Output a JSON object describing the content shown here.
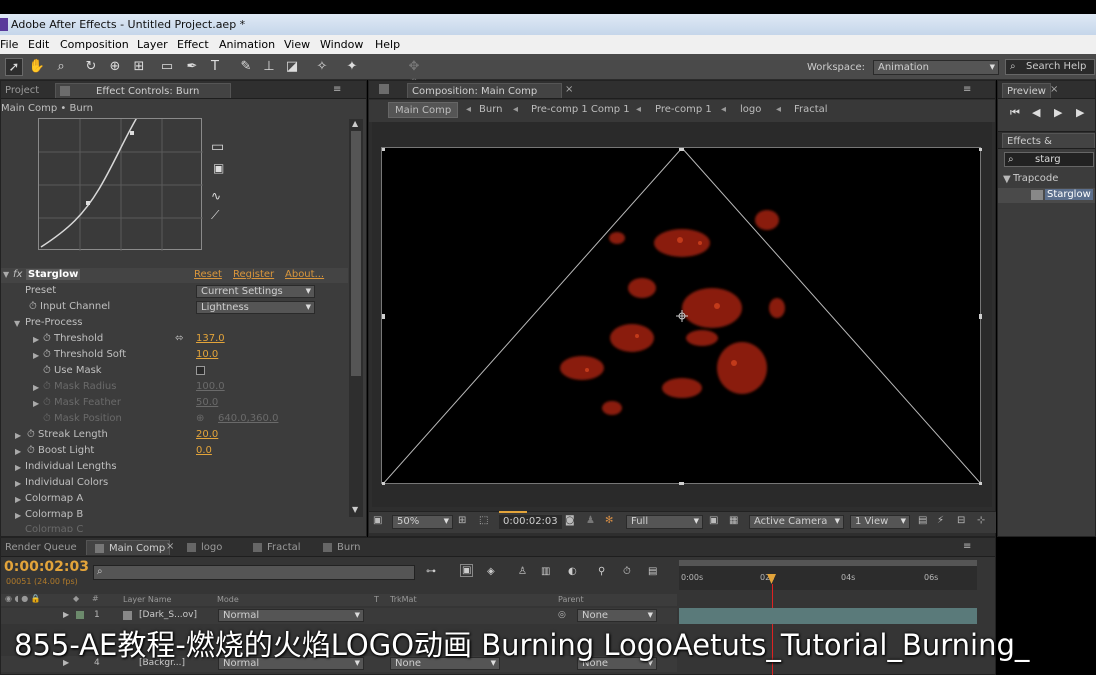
{
  "app": {
    "window_title": "Adobe After Effects - Untitled Project.aep *"
  },
  "menu": [
    "File",
    "Edit",
    "Composition",
    "Layer",
    "Effect",
    "Animation",
    "View",
    "Window",
    "Help"
  ],
  "toolbar": {
    "workspace_label": "Workspace:",
    "workspace_value": "Animation",
    "search_help": "Search Help"
  },
  "left_panel": {
    "tab_project": "Project",
    "tab_effect_controls": "Effect Controls: Burn",
    "breadcrumb": "Main Comp • Burn",
    "effect": {
      "name": "Starglow",
      "reset": "Reset",
      "register": "Register",
      "about": "About...",
      "preset_label": "Preset",
      "preset_value": "Current Settings",
      "input_channel_label": "Input Channel",
      "input_channel_value": "Lightness",
      "pre_process": "Pre-Process",
      "threshold_label": "Threshold",
      "threshold_value": "137.0",
      "threshold_soft_label": "Threshold Soft",
      "threshold_soft_value": "10.0",
      "use_mask_label": "Use Mask",
      "mask_radius_label": "Mask Radius",
      "mask_radius_value": "100.0",
      "mask_feather_label": "Mask Feather",
      "mask_feather_value": "50.0",
      "mask_position_label": "Mask Position",
      "mask_position_value": "640.0,360.0",
      "streak_length_label": "Streak Length",
      "streak_length_value": "20.0",
      "boost_light_label": "Boost Light",
      "boost_light_value": "0.0",
      "individual_lengths": "Individual Lengths",
      "individual_colors": "Individual Colors",
      "colormap_a": "Colormap A",
      "colormap_b": "Colormap B",
      "colormap_c": "Colormap C"
    }
  },
  "comp_panel": {
    "tab": "Composition: Main Comp",
    "breadcrumbs": [
      "Main Comp",
      "Burn",
      "Pre-comp 1 Comp 1",
      "Pre-comp 1",
      "logo",
      "Fractal"
    ],
    "zoom": "50%",
    "timecode": "0:00:02:03",
    "resolution": "Full",
    "camera": "Active Camera",
    "view": "1 View"
  },
  "right_panel": {
    "preview_tab": "Preview",
    "effects_tab": "Effects & Presets",
    "search_value": "starg",
    "category": "Trapcode",
    "item": "Starglow"
  },
  "timeline": {
    "tabs": [
      "Render Queue",
      "Main Comp",
      "logo",
      "Fractal",
      "Burn"
    ],
    "timecode": "0:00:02:03",
    "frame_info": "00051 (24.00 fps)",
    "columns": {
      "layer_name": "Layer Name",
      "mode": "Mode",
      "t": "T",
      "trkmat": "TrkMat",
      "parent": "Parent"
    },
    "ruler": [
      "0:00s",
      "02s",
      "04s",
      "06s"
    ],
    "rows": [
      {
        "num": "1",
        "name": "[Dark_S...ov]",
        "mode": "Normal",
        "trkmat": "",
        "parent": "None"
      },
      {
        "num": "4",
        "name": "[Backgr...]",
        "mode": "Normal",
        "trkmat": "None",
        "parent": "None"
      }
    ]
  },
  "subtitle": "855-AE教程-燃烧的火焰LOGO动画 Burning LogoAetuts_Tutorial_Burning_"
}
